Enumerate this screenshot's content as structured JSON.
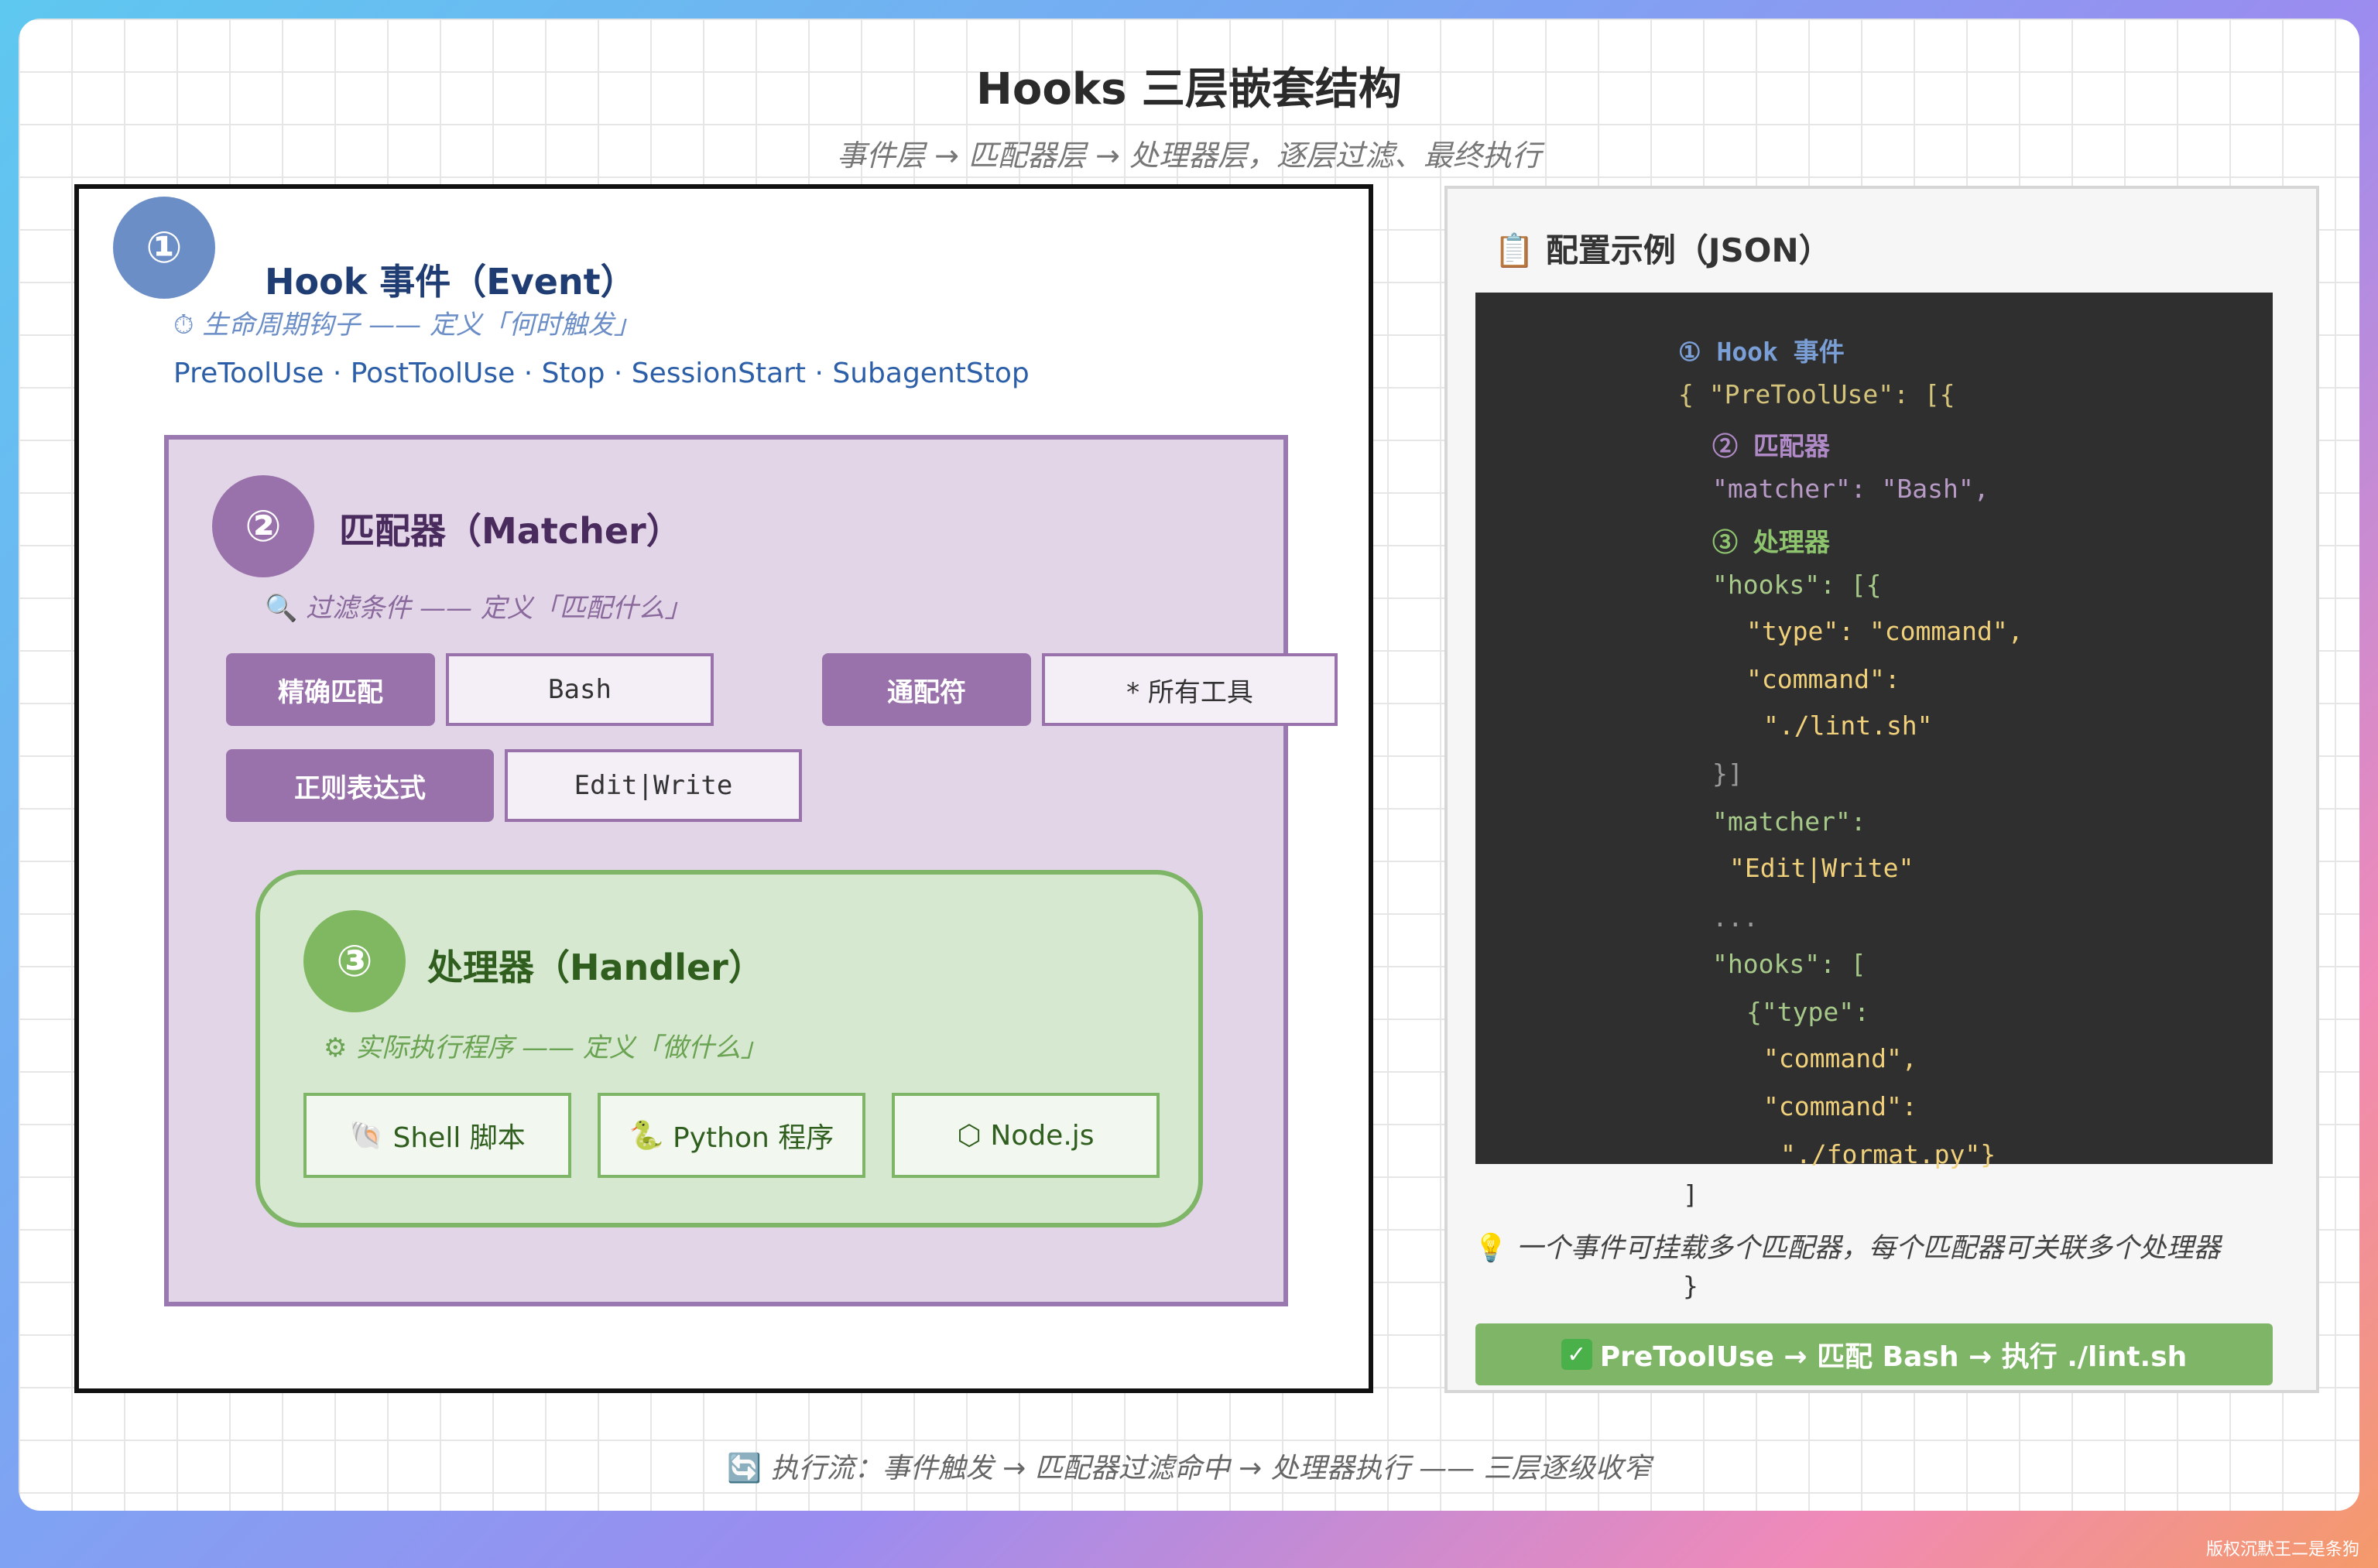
{
  "title": "Hooks 三层嵌套结构",
  "subtitle": "事件层 → 匹配器层 → 处理器层，逐层过滤、最终执行",
  "event": {
    "badge": "①",
    "title": "Hook 事件（Event）",
    "subtitle": "生命周期钩子 —— 定义「何时触发」",
    "subtitle_icon": "⏱",
    "list": "PreToolUse · PostToolUse · Stop · SessionStart · SubagentStop"
  },
  "matcher": {
    "badge": "②",
    "title": "匹配器（Matcher）",
    "subtitle": "过滤条件 —— 定义「匹配什么」",
    "subtitle_icon": "🔍",
    "rules": [
      {
        "label": "精确匹配",
        "value": "Bash"
      },
      {
        "label": "通配符",
        "value": "* 所有工具"
      },
      {
        "label": "正则表达式",
        "value": "Edit|Write"
      }
    ]
  },
  "handler": {
    "badge": "③",
    "title": "处理器（Handler）",
    "subtitle": "实际执行程序 —— 定义「做什么」",
    "subtitle_icon": "⚙",
    "types": [
      {
        "icon": "🐚",
        "label": "Shell 脚本"
      },
      {
        "icon": "🐍",
        "label": "Python 程序"
      },
      {
        "icon": "⬡",
        "label": "Node.js"
      }
    ]
  },
  "config": {
    "title_icon": "📋",
    "title": "配置示例（JSON）",
    "code": {
      "c1": "① Hook 事件",
      "c2": "{ \"PreToolUse\": [{",
      "c3": "② 匹配器",
      "c4": "\"matcher\": \"Bash\",",
      "c5": "③ 处理器",
      "c6": "\"hooks\": [{",
      "c7": "\"type\": \"command\",",
      "c8": "\"command\":",
      "c9": "\"./lint.sh\"",
      "c10": "}]",
      "c11": "\"matcher\":",
      "c12": "\"Edit|Write\"",
      "c13": "...",
      "c14": "\"hooks\": [",
      "c15": "{\"type\":",
      "c16": "\"command\",",
      "c17": "\"command\":",
      "c18": "\"./format.py\"}",
      "c19": "]",
      "c20": "}"
    },
    "tip_icon": "💡",
    "tip": "一个事件可挂载多个匹配器，每个匹配器可关联多个处理器",
    "exec_icon": "✓",
    "exec": "PreToolUse → 匹配 Bash → 执行 ./lint.sh"
  },
  "footer_icon": "🔄",
  "footer": "执行流：事件触发 → 匹配器过滤命中 → 处理器执行 —— 三层逐级收窄",
  "watermark": "版权沉默王二是条狗"
}
